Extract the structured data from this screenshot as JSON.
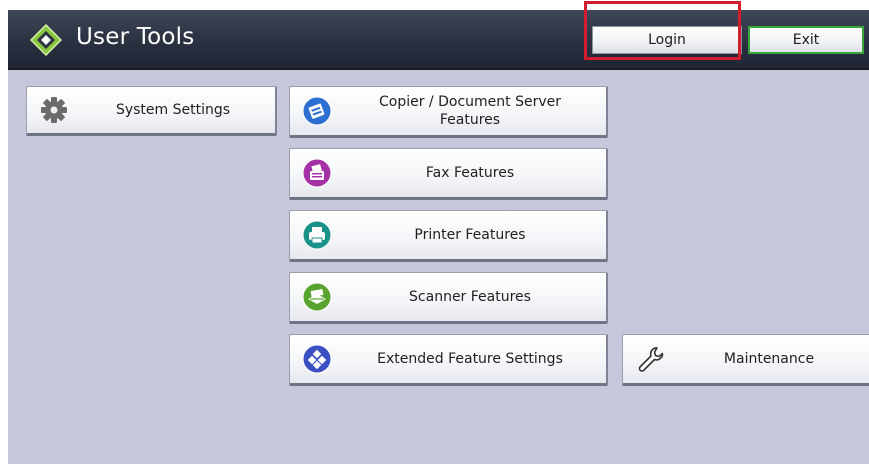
{
  "window": {
    "title": "User Tools",
    "app_icon": "user-tools-icon"
  },
  "header": {
    "login_label": "Login",
    "exit_label": "Exit"
  },
  "menu": {
    "system_settings": {
      "label": "System Settings",
      "icon": "gear-icon"
    },
    "copier": {
      "label_line1": "Copier / Document Server",
      "label_line2": "Features",
      "icon": "copier-icon"
    },
    "fax": {
      "label": "Fax Features",
      "icon": "fax-icon"
    },
    "printer": {
      "label": "Printer Features",
      "icon": "printer-icon"
    },
    "scanner": {
      "label": "Scanner Features",
      "icon": "scanner-icon"
    },
    "extended": {
      "label": "Extended Feature Settings",
      "icon": "extended-feature-icon"
    },
    "maintenance": {
      "label": "Maintenance",
      "icon": "wrench-icon"
    }
  },
  "colors": {
    "background": "#c6c7da",
    "titlebar": "#2a3140",
    "highlight": "#d41c2f",
    "exit_border": "#39a63a",
    "copier_icon": "#2b6fd0",
    "fax_icon": "#a531a6",
    "printer_icon": "#1a9289",
    "scanner_icon": "#58a22e",
    "extended_icon": "#3a4fc2"
  }
}
